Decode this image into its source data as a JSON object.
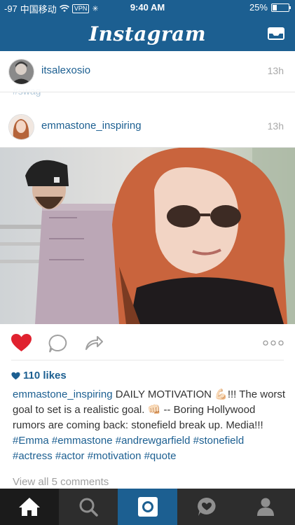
{
  "status_bar": {
    "signal": "-97",
    "carrier": "中国移动",
    "vpn": "VPN",
    "time": "9:40 AM",
    "battery": "25%"
  },
  "nav": {
    "title": "Instagram",
    "inbox_icon": "inbox-icon"
  },
  "previous_post": {
    "username": "itsalexosio",
    "time": "13h",
    "hashtag": "#swag"
  },
  "post": {
    "username": "emmastone_inspiring",
    "time": "13h",
    "likes": "110 likes",
    "caption_user": "emmastone_inspiring",
    "caption_text": "DAILY MOTIVATION 💪🏻!!! The worst goal to set is a realistic goal. 👊🏻 -- Boring Hollywood rumors are coming back: stonefield break up. Media!!!",
    "caption_tags": "#Emma #emmastone #andrewgarfield #stonefield #actress #actor #motivation #quote",
    "view_comments": "View all 5 comments",
    "liked": true
  },
  "tab_bar": {
    "tabs": [
      "home-icon",
      "search-icon",
      "camera-icon",
      "activity-icon",
      "profile-icon"
    ],
    "active": 2
  },
  "colors": {
    "brand": "#1c5f91",
    "like": "#e0222f"
  }
}
